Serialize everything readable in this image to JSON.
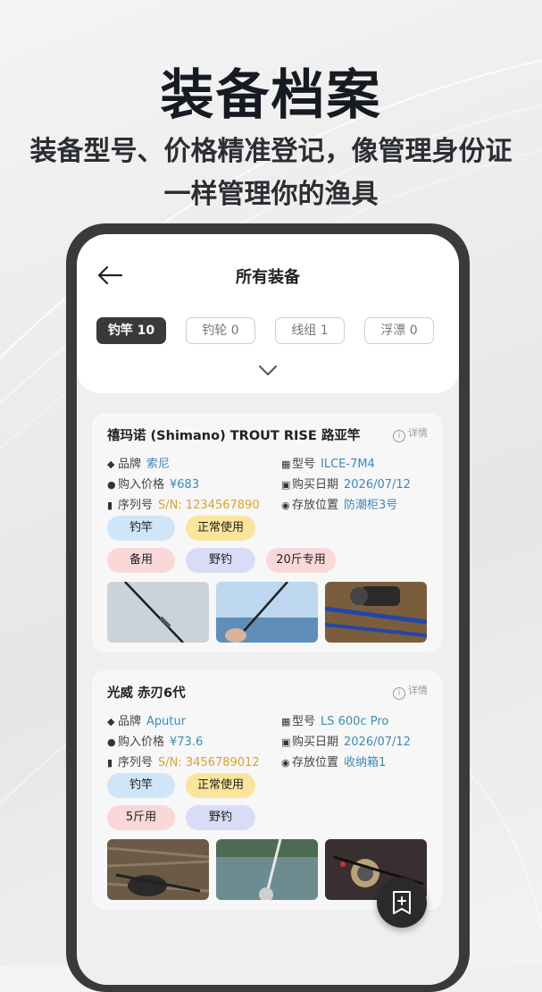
{
  "promo": {
    "title": "装备档案",
    "subtitle": "装备型号、价格精准登记，像管理身份证一样管理你的渔具"
  },
  "nav": {
    "title": "所有装备"
  },
  "categories": [
    {
      "label": "钓竿 10",
      "active": true
    },
    {
      "label": "钓轮 0",
      "active": false
    },
    {
      "label": "线组 1",
      "active": false
    },
    {
      "label": "浮漂 0",
      "active": false
    }
  ],
  "gear": [
    {
      "title": "禧玛诺 (Shimano) TROUT RISE 路亚竿",
      "detail": "详情",
      "brand_label": "品牌",
      "brand": "索尼",
      "model_label": "型号",
      "model": "ILCE-7M4",
      "price_label": "购入价格",
      "price": "¥683",
      "date_label": "购买日期",
      "date": "2026/07/12",
      "serial_label": "序列号",
      "serial": "S/N: 1234567890",
      "storage_label": "存放位置",
      "storage": "防潮柜3号",
      "tags": [
        "钓竿",
        "正常使用",
        "备用",
        "野钓",
        "20斤专用"
      ],
      "photos": [
        "rod-on-snow-photo",
        "rod-by-lake-photo",
        "blue-rods-photo"
      ]
    },
    {
      "title": "光威 赤刃6代",
      "detail": "详情",
      "brand_label": "品牌",
      "brand": "Aputur",
      "model_label": "型号",
      "model": "LS 600c Pro",
      "price_label": "购入价格",
      "price": "¥73.6",
      "date_label": "购买日期",
      "date": "2026/07/12",
      "serial_label": "序列号",
      "serial": "S/N: 3456789012",
      "storage_label": "存放位置",
      "storage": "收纳箱1",
      "tags": [
        "钓竿",
        "正常使用",
        "5斤用",
        "野钓"
      ],
      "photos": [
        "reel-on-grass-photo",
        "rod-over-river-photo",
        "reel-closeup-photo"
      ]
    }
  ],
  "colors": {
    "accent_blue": "#3d8ab5",
    "serial_orange": "#d9a428",
    "tag_blue": "#cfe5f8",
    "tag_yellow": "#fbe59a",
    "tag_pink": "#fad8d8",
    "tag_lavender": "#d9dcf7"
  },
  "icons": {
    "back": "arrow-left-icon",
    "expand": "chevron-down-icon",
    "detail": "info-icon",
    "brand": "tag-icon",
    "model": "barcode-card-icon",
    "price": "money-icon",
    "date": "calendar-icon",
    "serial": "barcode-icon",
    "storage": "location-pin-icon",
    "fab": "add-note-icon"
  }
}
